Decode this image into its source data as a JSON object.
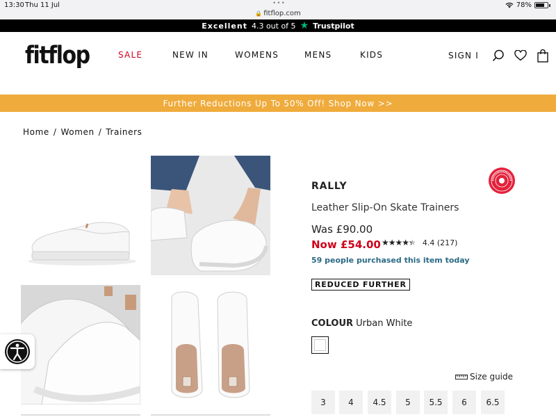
{
  "status_bar": {
    "time": "13:30",
    "date": "Thu 11 Jul",
    "url": "fitflop.com",
    "battery": "78%",
    "battery_level": 0.78
  },
  "trustpilot": {
    "rating_word": "Excellent",
    "score_text": "4.3 out of 5",
    "brand": "Trustpilot"
  },
  "header": {
    "logo": "fitflop",
    "nav": [
      "SALE",
      "NEW IN",
      "WOMENS",
      "MENS",
      "KIDS"
    ],
    "sign_in": "SIGN I"
  },
  "promo": {
    "text": "Further Reductions Up To 50% Off! Shop Now >>"
  },
  "breadcrumb": [
    "Home",
    "Women",
    "Trainers"
  ],
  "product": {
    "name": "RALLY",
    "subtitle": "Leather Slip-On Skate Trainers",
    "was_price": "Was £90.00",
    "now_price": "Now £54.00",
    "rating": 4.4,
    "rating_text": "4.4 (217)",
    "stars_glyphs": "★★★★★",
    "purchased_text": "59 people purchased this item today",
    "badge": "REDUCED FURTHER",
    "colour_label": "COLOUR",
    "colour_value": "Urban White",
    "size_guide": "Size guide",
    "sizes": [
      "3",
      "4",
      "4.5",
      "5",
      "5.5",
      "6",
      "6.5"
    ]
  },
  "colors": {
    "sale_red": "#d0021b",
    "promo_orange": "#efab3c",
    "purchased_teal": "#2b6a85",
    "trustpilot_green": "#00b67a",
    "badge_red": "#e4213c"
  }
}
